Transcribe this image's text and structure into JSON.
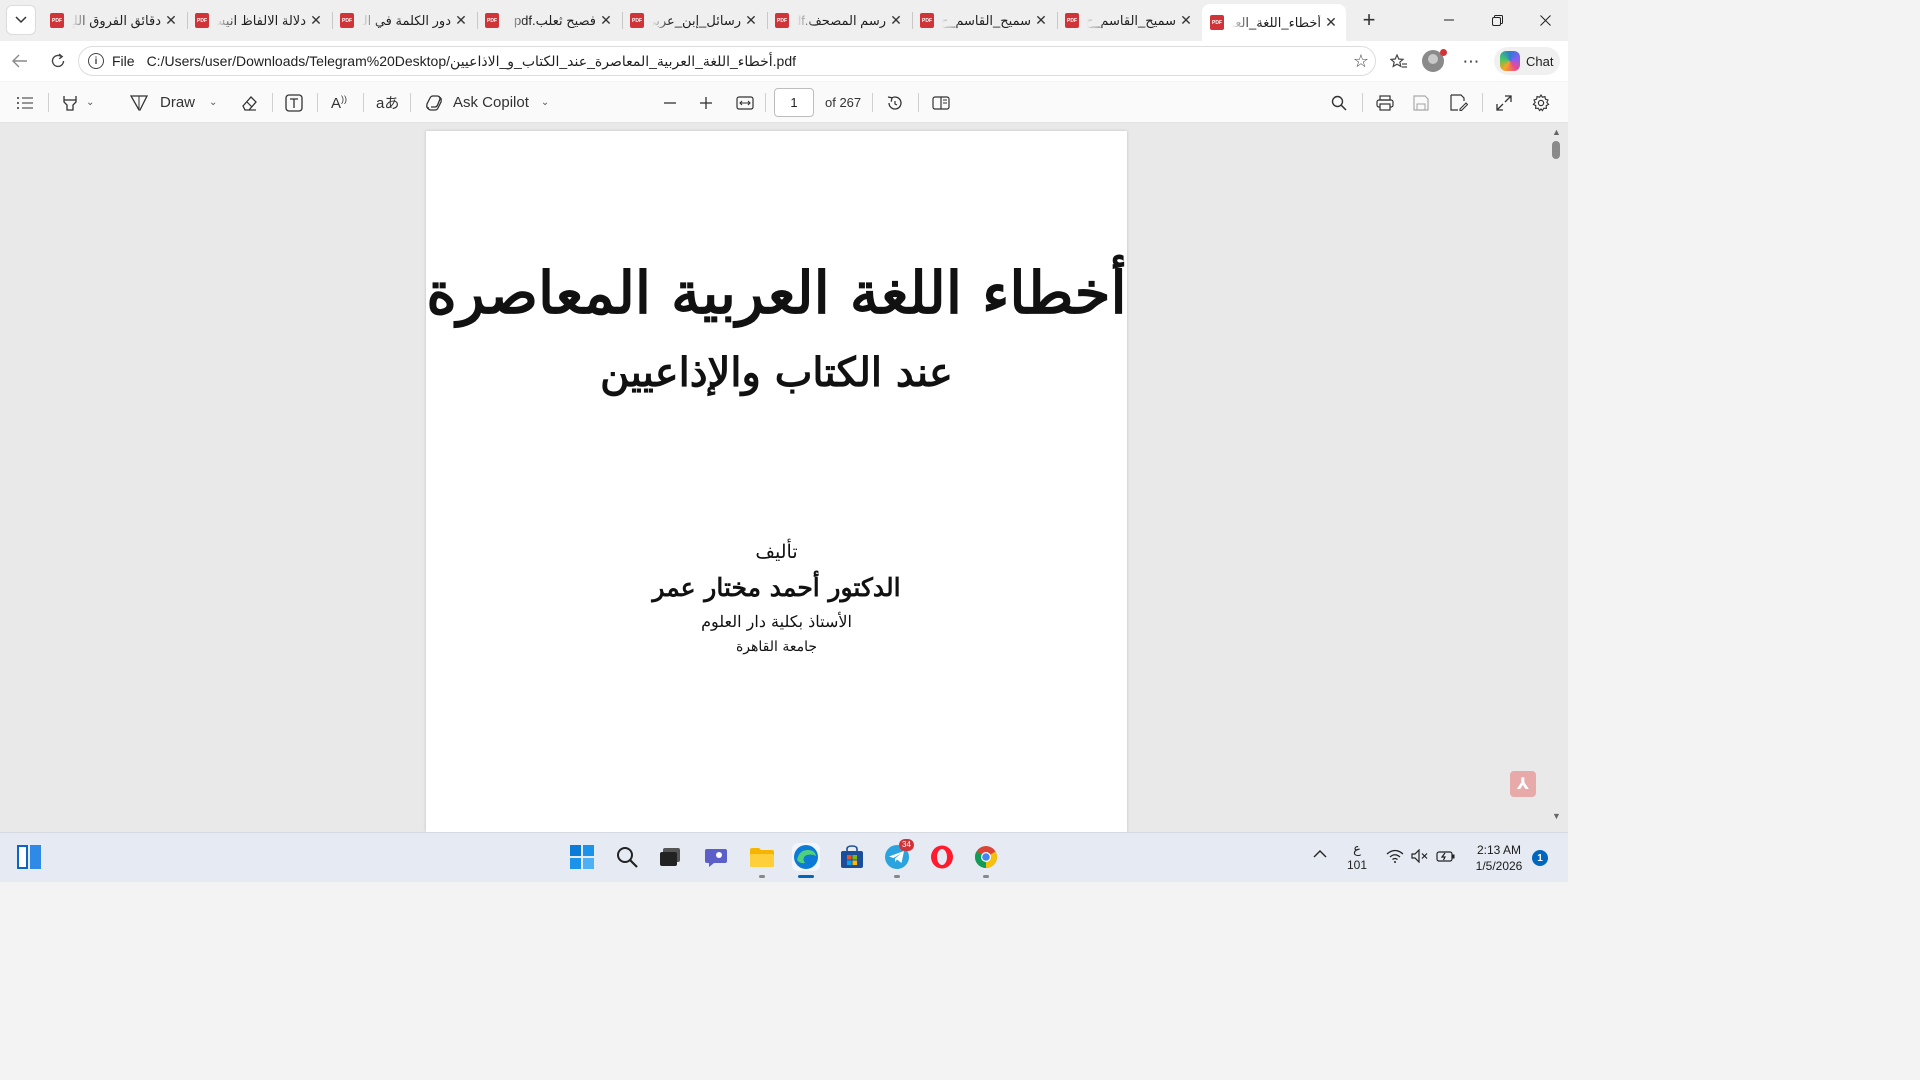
{
  "tabs": [
    {
      "title": "دقائق الفروق اللغ",
      "active": false
    },
    {
      "title": "دلالة الالفاظ انيس",
      "active": false
    },
    {
      "title": "دور الكلمة في الل",
      "active": false
    },
    {
      "title": "فصيح ثعلب.pdf",
      "active": false
    },
    {
      "title": "رسائل_إبن_عربي_",
      "active": false
    },
    {
      "title": "رسم المصحف.pdf",
      "active": false
    },
    {
      "title": "سميح_القاسم_ح",
      "active": false
    },
    {
      "title": "سميح_القاسم_ح",
      "active": false
    },
    {
      "title": "أخطاء_اللغة_العر",
      "active": true
    }
  ],
  "tab_icon_label": "PDF",
  "address_bar": {
    "scheme": "File",
    "url": "C:/Users/user/Downloads/Telegram%20Desktop/أخطاء_اللغة_العربية_المعاصرة_عند_الكتاب_و_الاذاعيين.pdf"
  },
  "chat_label": "Chat",
  "toolbar": {
    "draw_label": "Draw",
    "copilot_label": "Ask Copilot",
    "page_number": "1",
    "page_count": "of 267"
  },
  "document": {
    "title_line1": "أخطاء اللغة العربية المعاصرة",
    "title_line2": "عند الكتاب والإذاعيين",
    "author_heading": "تأليف",
    "author_name": "الدكتور أحمد مختار عمر",
    "author_position": "الأستاذ بكلية دار العلوم",
    "author_university": "جامعة القاهرة"
  },
  "taskbar": {
    "telegram_badge": "34",
    "keyboard_lang": "ع",
    "keyboard_layout": "101",
    "time": "2:13 AM",
    "date": "1/5/2026",
    "notification_count": "1"
  },
  "colors": {
    "accent": "#0067c0",
    "pdf_red": "#d13438",
    "page_bg": "#ffffff",
    "viewer_bg": "#e9e9e9"
  },
  "icons": [
    "tab-list-icon",
    "pdf-icon",
    "close-icon",
    "new-tab-icon",
    "minimize-icon",
    "restore-icon",
    "window-close-icon",
    "back-icon",
    "refresh-icon",
    "info-icon",
    "favorite-star-icon",
    "favorites-icon",
    "profile-icon",
    "more-icon",
    "copilot-icon",
    "contents-icon",
    "highlight-icon",
    "draw-icon",
    "erase-icon",
    "text-icon",
    "read-aloud-icon",
    "translate-icon",
    "zoom-out-icon",
    "zoom-in-icon",
    "fit-page-icon",
    "rotate-icon",
    "page-view-icon",
    "search-icon",
    "print-icon",
    "save-icon",
    "save-as-icon",
    "fullscreen-icon",
    "settings-icon",
    "acrobat-icon",
    "windows-start-icon",
    "taskbar-search-icon",
    "task-view-icon",
    "chat-icon",
    "file-explorer-icon",
    "edge-icon",
    "store-icon",
    "telegram-icon",
    "opera-icon",
    "chrome-icon",
    "chevron-up-icon",
    "wifi-icon",
    "volume-muted-icon",
    "battery-icon"
  ]
}
